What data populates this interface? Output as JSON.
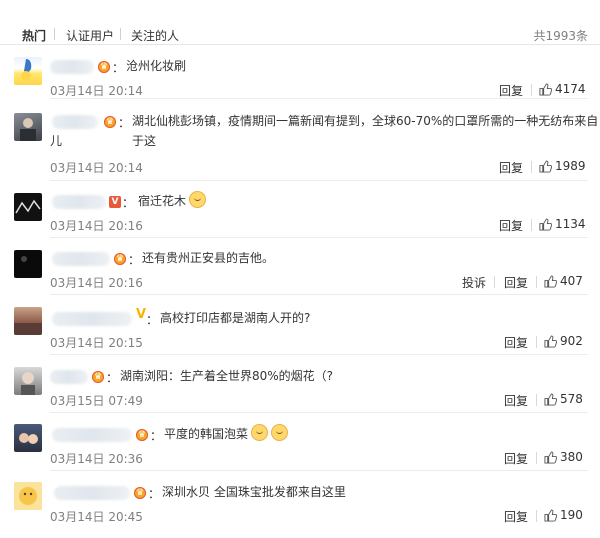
{
  "tabs": {
    "hot": "热门",
    "verified": "认证用户",
    "following": "关注的人",
    "total": "共1993条"
  },
  "actions": {
    "reply": "回复",
    "report": "投诉"
  },
  "comments": [
    {
      "text": "沧州化妆刷",
      "time": "03月14日 20:14",
      "likes": "4174"
    },
    {
      "text": "湖北仙桃彭场镇，疫情期间一篇新闻有提到，全球60-70%的口罩所需的一种无纺布来自于这",
      "text2": "儿",
      "time": "03月14日 20:14",
      "likes": "1989"
    },
    {
      "text": "宿迁花木",
      "time": "03月14日 20:16",
      "likes": "1134"
    },
    {
      "text": "还有贵州正安县的吉他。",
      "time": "03月14日 20:16",
      "likes": "407"
    },
    {
      "text": "高校打印店都是湖南人开的?",
      "time": "03月14日 20:15",
      "likes": "902"
    },
    {
      "text": "湖南浏阳：生产着全世界80%的烟花（?",
      "time": "03月15日 07:49",
      "likes": "578"
    },
    {
      "text": "平度的韩国泡菜",
      "time": "03月14日 20:36",
      "likes": "380"
    },
    {
      "text": "深圳水贝 全国珠宝批发都来自这里",
      "time": "03月14日 20:45",
      "likes": "190"
    }
  ],
  "colors": {
    "text": "#333333",
    "muted": "#808080",
    "divider": "#ececec",
    "vip_badge": "#f5a623"
  },
  "icons": [
    "thumb-up-icon",
    "vip-badge-icon",
    "emoji-icon"
  ]
}
